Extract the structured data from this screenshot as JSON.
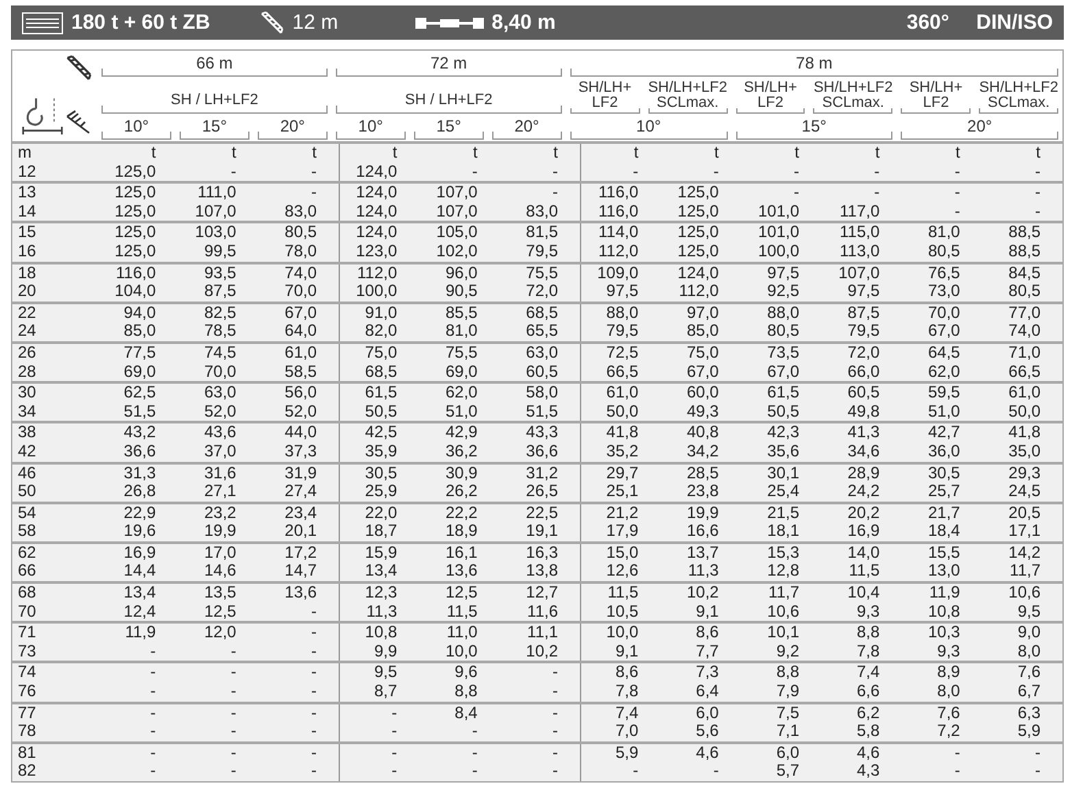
{
  "title_bar": {
    "counterweight": "180 t + 60 t ZB",
    "jib": "12 m",
    "track": "8,40 m",
    "slew": "360°",
    "standard": "DIN/ISO"
  },
  "table": {
    "groups": [
      {
        "kind": "uniform",
        "length": "66 m",
        "config": "SH / LH+LF2",
        "angles": [
          "10°",
          "15°",
          "20°"
        ]
      },
      {
        "kind": "uniform",
        "length": "72 m",
        "config": "SH / LH+LF2",
        "angles": [
          "10°",
          "15°",
          "20°"
        ]
      },
      {
        "kind": "split",
        "length": "78 m",
        "angles": [
          {
            "angle": "10°",
            "configs": [
              [
                "SH/LH+",
                "LF2"
              ],
              [
                "SH/LH+LF2",
                "SCLmax."
              ]
            ]
          },
          {
            "angle": "15°",
            "configs": [
              [
                "SH/LH+",
                "LF2"
              ],
              [
                "SH/LH+LF2",
                "SCLmax."
              ]
            ]
          },
          {
            "angle": "20°",
            "configs": [
              [
                "SH/LH+",
                "LF2"
              ],
              [
                "SH/LH+LF2",
                "SCLmax."
              ]
            ]
          }
        ]
      }
    ],
    "units": [
      "m",
      "t",
      "t",
      "t",
      "t",
      "t",
      "t",
      "t",
      "t",
      "t",
      "t",
      "t",
      "t"
    ],
    "rows": [
      {
        "radius": "12",
        "values": [
          "125,0",
          "-",
          "-",
          "124,0",
          "-",
          "-",
          "-",
          "-",
          "-",
          "-",
          "-",
          "-"
        ]
      },
      {
        "radius": "13",
        "values": [
          "125,0",
          "111,0",
          "-",
          "124,0",
          "107,0",
          "-",
          "116,0",
          "125,0",
          "-",
          "-",
          "-",
          "-"
        ]
      },
      {
        "radius": "14",
        "values": [
          "125,0",
          "107,0",
          "83,0",
          "124,0",
          "107,0",
          "83,0",
          "116,0",
          "125,0",
          "101,0",
          "117,0",
          "-",
          "-"
        ]
      },
      {
        "radius": "15",
        "values": [
          "125,0",
          "103,0",
          "80,5",
          "124,0",
          "105,0",
          "81,5",
          "114,0",
          "125,0",
          "101,0",
          "115,0",
          "81,0",
          "88,5"
        ]
      },
      {
        "radius": "16",
        "values": [
          "125,0",
          "99,5",
          "78,0",
          "123,0",
          "102,0",
          "79,5",
          "112,0",
          "125,0",
          "100,0",
          "113,0",
          "80,5",
          "88,5"
        ]
      },
      {
        "radius": "18",
        "values": [
          "116,0",
          "93,5",
          "74,0",
          "112,0",
          "96,0",
          "75,5",
          "109,0",
          "124,0",
          "97,5",
          "107,0",
          "76,5",
          "84,5"
        ]
      },
      {
        "radius": "20",
        "values": [
          "104,0",
          "87,5",
          "70,0",
          "100,0",
          "90,5",
          "72,0",
          "97,5",
          "112,0",
          "92,5",
          "97,5",
          "73,0",
          "80,5"
        ]
      },
      {
        "radius": "22",
        "values": [
          "94,0",
          "82,5",
          "67,0",
          "91,0",
          "85,5",
          "68,5",
          "88,0",
          "97,0",
          "88,0",
          "87,5",
          "70,0",
          "77,0"
        ]
      },
      {
        "radius": "24",
        "values": [
          "85,0",
          "78,5",
          "64,0",
          "82,0",
          "81,0",
          "65,5",
          "79,5",
          "85,0",
          "80,5",
          "79,5",
          "67,0",
          "74,0"
        ]
      },
      {
        "radius": "26",
        "values": [
          "77,5",
          "74,5",
          "61,0",
          "75,0",
          "75,5",
          "63,0",
          "72,5",
          "75,0",
          "73,5",
          "72,0",
          "64,5",
          "71,0"
        ]
      },
      {
        "radius": "28",
        "values": [
          "69,0",
          "70,0",
          "58,5",
          "68,5",
          "69,0",
          "60,5",
          "66,5",
          "67,0",
          "67,0",
          "66,0",
          "62,0",
          "66,5"
        ]
      },
      {
        "radius": "30",
        "values": [
          "62,5",
          "63,0",
          "56,0",
          "61,5",
          "62,0",
          "58,0",
          "61,0",
          "60,0",
          "61,5",
          "60,5",
          "59,5",
          "61,0"
        ]
      },
      {
        "radius": "34",
        "values": [
          "51,5",
          "52,0",
          "52,0",
          "50,5",
          "51,0",
          "51,5",
          "50,0",
          "49,3",
          "50,5",
          "49,8",
          "51,0",
          "50,0"
        ]
      },
      {
        "radius": "38",
        "values": [
          "43,2",
          "43,6",
          "44,0",
          "42,5",
          "42,9",
          "43,3",
          "41,8",
          "40,8",
          "42,3",
          "41,3",
          "42,7",
          "41,8"
        ]
      },
      {
        "radius": "42",
        "values": [
          "36,6",
          "37,0",
          "37,3",
          "35,9",
          "36,2",
          "36,6",
          "35,2",
          "34,2",
          "35,6",
          "34,6",
          "36,0",
          "35,0"
        ]
      },
      {
        "radius": "46",
        "values": [
          "31,3",
          "31,6",
          "31,9",
          "30,5",
          "30,9",
          "31,2",
          "29,7",
          "28,5",
          "30,1",
          "28,9",
          "30,5",
          "29,3"
        ]
      },
      {
        "radius": "50",
        "values": [
          "26,8",
          "27,1",
          "27,4",
          "25,9",
          "26,2",
          "26,5",
          "25,1",
          "23,8",
          "25,4",
          "24,2",
          "25,7",
          "24,5"
        ]
      },
      {
        "radius": "54",
        "values": [
          "22,9",
          "23,2",
          "23,4",
          "22,0",
          "22,2",
          "22,5",
          "21,2",
          "19,9",
          "21,5",
          "20,2",
          "21,7",
          "20,5"
        ]
      },
      {
        "radius": "58",
        "values": [
          "19,6",
          "19,9",
          "20,1",
          "18,7",
          "18,9",
          "19,1",
          "17,9",
          "16,6",
          "18,1",
          "16,9",
          "18,4",
          "17,1"
        ]
      },
      {
        "radius": "62",
        "values": [
          "16,9",
          "17,0",
          "17,2",
          "15,9",
          "16,1",
          "16,3",
          "15,0",
          "13,7",
          "15,3",
          "14,0",
          "15,5",
          "14,2"
        ]
      },
      {
        "radius": "66",
        "values": [
          "14,4",
          "14,6",
          "14,7",
          "13,4",
          "13,6",
          "13,8",
          "12,6",
          "11,3",
          "12,8",
          "11,5",
          "13,0",
          "11,7"
        ]
      },
      {
        "radius": "68",
        "values": [
          "13,4",
          "13,5",
          "13,6",
          "12,3",
          "12,5",
          "12,7",
          "11,5",
          "10,2",
          "11,7",
          "10,4",
          "11,9",
          "10,6"
        ]
      },
      {
        "radius": "70",
        "values": [
          "12,4",
          "12,5",
          "-",
          "11,3",
          "11,5",
          "11,6",
          "10,5",
          "9,1",
          "10,6",
          "9,3",
          "10,8",
          "9,5"
        ]
      },
      {
        "radius": "71",
        "values": [
          "11,9",
          "12,0",
          "-",
          "10,8",
          "11,0",
          "11,1",
          "10,0",
          "8,6",
          "10,1",
          "8,8",
          "10,3",
          "9,0"
        ]
      },
      {
        "radius": "73",
        "values": [
          "-",
          "-",
          "-",
          "9,9",
          "10,0",
          "10,2",
          "9,1",
          "7,7",
          "9,2",
          "7,8",
          "9,3",
          "8,0"
        ]
      },
      {
        "radius": "74",
        "values": [
          "-",
          "-",
          "-",
          "9,5",
          "9,6",
          "-",
          "8,6",
          "7,3",
          "8,8",
          "7,4",
          "8,9",
          "7,6"
        ]
      },
      {
        "radius": "76",
        "values": [
          "-",
          "-",
          "-",
          "8,7",
          "8,8",
          "-",
          "7,8",
          "6,4",
          "7,9",
          "6,6",
          "8,0",
          "6,7"
        ]
      },
      {
        "radius": "77",
        "values": [
          "-",
          "-",
          "-",
          "-",
          "8,4",
          "-",
          "7,4",
          "6,0",
          "7,5",
          "6,2",
          "7,6",
          "6,3"
        ]
      },
      {
        "radius": "78",
        "values": [
          "-",
          "-",
          "-",
          "-",
          "-",
          "-",
          "7,0",
          "5,6",
          "7,1",
          "5,8",
          "7,2",
          "5,9"
        ]
      },
      {
        "radius": "81",
        "values": [
          "-",
          "-",
          "-",
          "-",
          "-",
          "-",
          "5,9",
          "4,6",
          "6,0",
          "4,6",
          "-",
          "-"
        ]
      },
      {
        "radius": "82",
        "values": [
          "-",
          "-",
          "-",
          "-",
          "-",
          "-",
          "-",
          "-",
          "5,7",
          "4,3",
          "-",
          "-"
        ]
      }
    ]
  }
}
